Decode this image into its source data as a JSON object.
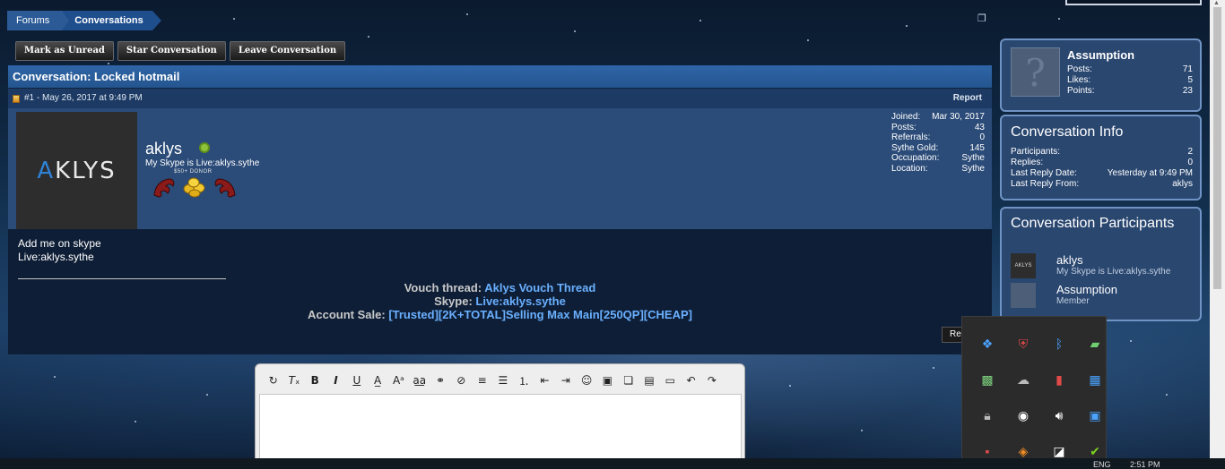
{
  "breadcrumb": {
    "forums": "Forums",
    "current": "Conversations"
  },
  "toolbar": {
    "mark_unread": "Mark as Unread",
    "star": "Star Conversation",
    "leave": "Leave Conversation"
  },
  "conversation": {
    "title": "Conversation: Locked hotmail",
    "post_meta": "#1 - May 26, 2017 at 9:49 PM",
    "report": "Report",
    "avatar_logo_a": "A",
    "avatar_logo_rest": "KLYS",
    "username": "aklys",
    "user_title": "My Skype is Live:aklys.sythe",
    "badge_caption": "$50+  DONOR",
    "stats": [
      {
        "label": "Joined:",
        "value": "Mar 30, 2017"
      },
      {
        "label": "Posts:",
        "value": "43"
      },
      {
        "label": "Referrals:",
        "value": "0"
      },
      {
        "label": "Sythe Gold:",
        "value": "145"
      },
      {
        "label": "Occupation:",
        "value": "Sythe"
      },
      {
        "label": "Location:",
        "value": "Sythe"
      }
    ],
    "body_line1": "Add me on skype",
    "body_line2": "Live:aklys.sythe",
    "sig": {
      "vouch_label": "Vouch thread: ",
      "vouch_link": "Aklys Vouch Thread",
      "skype_label": "Skype: ",
      "skype_link": "Live:aklys.sythe",
      "sale_label": "Account Sale: ",
      "sale_link": "[Trusted][2K+TOTAL]Selling Max Main[250QP][CHEAP]"
    },
    "reply_cut": "Re"
  },
  "sidebar": {
    "user": {
      "name": "Assumption",
      "stats": [
        {
          "label": "Posts:",
          "value": "71"
        },
        {
          "label": "Likes:",
          "value": "5"
        },
        {
          "label": "Points:",
          "value": "23"
        }
      ]
    },
    "info": {
      "title": "Conversation Info",
      "stats": [
        {
          "label": "Participants:",
          "value": "2"
        },
        {
          "label": "Replies:",
          "value": "0"
        },
        {
          "label": "Last Reply Date:",
          "value": "Yesterday at 9:49 PM"
        },
        {
          "label": "Last Reply From:",
          "value": "aklys"
        }
      ]
    },
    "participants": {
      "title": "Conversation Participants",
      "items": [
        {
          "name": "aklys",
          "sub": "My Skype is Live:aklys.sythe",
          "avatar": "AKLYS"
        },
        {
          "name": "Assumption",
          "sub": "Member",
          "avatar": "?"
        }
      ]
    }
  },
  "taskbar": {
    "lang": "ENG",
    "time": "2:51 PM"
  },
  "colors": {
    "accent": "#24558f",
    "link": "#6ab0ff",
    "online": "#8ec23a"
  }
}
